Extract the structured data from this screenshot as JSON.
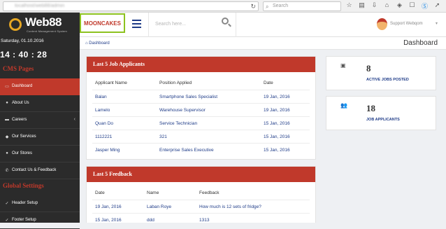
{
  "browser": {
    "url": "localhost/web88/admin",
    "search_placeholder": "Search",
    "icons": [
      "star-icon",
      "clipboard-icon",
      "download-icon",
      "home-icon",
      "shield-icon",
      "chat-icon",
      "skype-icon",
      "arrow-icon",
      "menu-icon"
    ]
  },
  "header": {
    "logo": "Web88",
    "logo_sub": "Content Management System",
    "store_button": "MOONCAKES",
    "search_placeholder": "Search here...",
    "user_label": "Support Webqom",
    "user_caret": "▾"
  },
  "sidebar": {
    "date": "Saturday, 01.10.2016",
    "clock": "14 : 40 : 28",
    "cms_title": "CMS Pages",
    "items": [
      {
        "label": "Dashboard",
        "icon": "monitor-icon",
        "glyph": "▭",
        "active": true
      },
      {
        "label": "About Us",
        "icon": "user-icon",
        "glyph": "●",
        "active": false
      },
      {
        "label": "Careers",
        "icon": "briefcase-icon",
        "glyph": "▬",
        "active": false,
        "caret": "‹"
      },
      {
        "label": "Our Services",
        "icon": "tag-icon",
        "glyph": "◆",
        "active": false
      },
      {
        "label": "Our Stores",
        "icon": "pin-icon",
        "glyph": "●",
        "active": false
      },
      {
        "label": "Contact Us & Feedback",
        "icon": "phone-icon",
        "glyph": "✆",
        "active": false
      }
    ],
    "global_title": "Global Settings",
    "global_items": [
      {
        "label": "Header Setup",
        "icon": "check-icon",
        "glyph": "✓"
      },
      {
        "label": "Footer Setup",
        "icon": "check-icon",
        "glyph": "✓"
      }
    ]
  },
  "main": {
    "breadcrumb": "Dashboard",
    "breadcrumb_icon": "⌂",
    "page_title": "Dashboard",
    "applicants": {
      "title": "Last 5 Job Applicants",
      "columns": [
        "Applicant Name",
        "Position Applied",
        "Date"
      ],
      "rows": [
        [
          "Balan",
          "Smartphone Sales Specialist",
          "19 Jan, 2016"
        ],
        [
          "Lamelo",
          "Warehouse Supervisor",
          "19 Jan, 2016"
        ],
        [
          "Quan Do",
          "Service Technician",
          "15 Jan, 2016"
        ],
        [
          "1112221",
          "321",
          "15 Jan, 2016"
        ],
        [
          "Jasper Ming",
          "Enterprise Sales Executive",
          "15 Jan, 2016"
        ]
      ]
    },
    "feedback": {
      "title": "Last 5 Feedback",
      "columns": [
        "Date",
        "Name",
        "Feedback"
      ],
      "rows": [
        [
          "19 Jan, 2016",
          "Laban Roye",
          "How much is 12 sets of fridge?"
        ],
        [
          "15 Jan, 2016",
          "ddd",
          "1313"
        ]
      ]
    },
    "stats": [
      {
        "value": "8",
        "label": "ACTIVE JOBS POSTED",
        "icon": "briefcase-icon",
        "glyph": "▣"
      },
      {
        "value": "18",
        "label": "JOB APPLICANTS",
        "icon": "users-icon",
        "glyph": "👥"
      }
    ]
  },
  "colors": {
    "accent": "#c0392b",
    "sidebar": "#2b2b2b",
    "link": "#1f3c88",
    "highlight": "#8dc21f",
    "logo_ring": "#e5a623"
  }
}
